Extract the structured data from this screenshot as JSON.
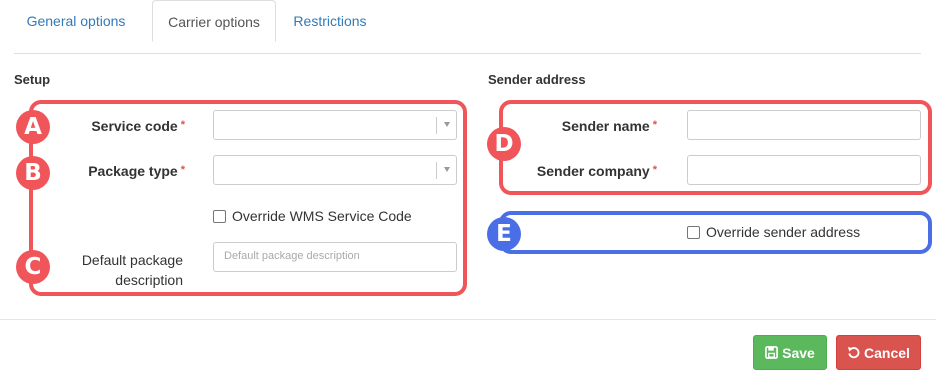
{
  "tabs": [
    {
      "label": "General options",
      "active": false
    },
    {
      "label": "Carrier options",
      "active": true
    },
    {
      "label": "Restrictions",
      "active": false
    }
  ],
  "setup": {
    "title": "Setup",
    "service_code_label": "Service code",
    "package_type_label": "Package type",
    "override_wms_label": "Override WMS Service Code",
    "default_package_label_line1": "Default package",
    "default_package_label_line2": "description",
    "default_package_placeholder": "Default package description",
    "required_mark": "*"
  },
  "sender": {
    "title": "Sender address",
    "sender_name_label": "Sender name",
    "sender_company_label": "Sender company",
    "override_sender_label": "Override sender address",
    "required_mark": "*"
  },
  "markers": {
    "a": "A",
    "b": "B",
    "c": "C",
    "d": "D",
    "e": "E"
  },
  "footer": {
    "save_label": "Save",
    "cancel_label": "Cancel",
    "save_icon": "floppy-icon",
    "cancel_icon": "undo-icon"
  },
  "colors": {
    "annotation_red": "#f0555a",
    "annotation_blue": "#4a6ee6",
    "save_green": "#5cb85c",
    "cancel_red": "#d9534f",
    "link_blue": "#337ab7"
  }
}
